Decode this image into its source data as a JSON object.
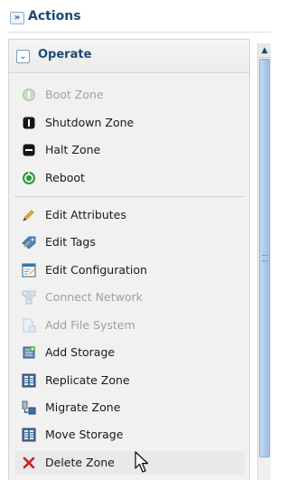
{
  "header": {
    "title": "Actions",
    "toggle_icon": "double-chevron-right-icon"
  },
  "section": {
    "label": "Operate",
    "toggle_icon": "chevron-down-icon",
    "accent": "#1c4a73"
  },
  "groups": [
    [
      {
        "label": "Boot Zone",
        "icon": "boot-zone-icon",
        "enabled": false
      },
      {
        "label": "Shutdown Zone",
        "icon": "shutdown-zone-icon",
        "enabled": true
      },
      {
        "label": "Halt Zone",
        "icon": "halt-zone-icon",
        "enabled": true
      },
      {
        "label": "Reboot",
        "icon": "reboot-icon",
        "enabled": true
      }
    ],
    [
      {
        "label": "Edit Attributes",
        "icon": "pencil-icon",
        "enabled": true
      },
      {
        "label": "Edit Tags",
        "icon": "tag-icon",
        "enabled": true
      },
      {
        "label": "Edit Configuration",
        "icon": "edit-configuration-icon",
        "enabled": true
      },
      {
        "label": "Connect Network",
        "icon": "connect-network-icon",
        "enabled": false
      },
      {
        "label": "Add File System",
        "icon": "add-file-system-icon",
        "enabled": false
      },
      {
        "label": "Add Storage",
        "icon": "add-storage-icon",
        "enabled": true
      },
      {
        "label": "Replicate Zone",
        "icon": "replicate-zone-icon",
        "enabled": true
      },
      {
        "label": "Migrate Zone",
        "icon": "migrate-zone-icon",
        "enabled": true
      },
      {
        "label": "Move Storage",
        "icon": "move-storage-icon",
        "enabled": true
      },
      {
        "label": "Delete Zone",
        "icon": "delete-icon",
        "enabled": true,
        "hovered": true
      }
    ]
  ]
}
